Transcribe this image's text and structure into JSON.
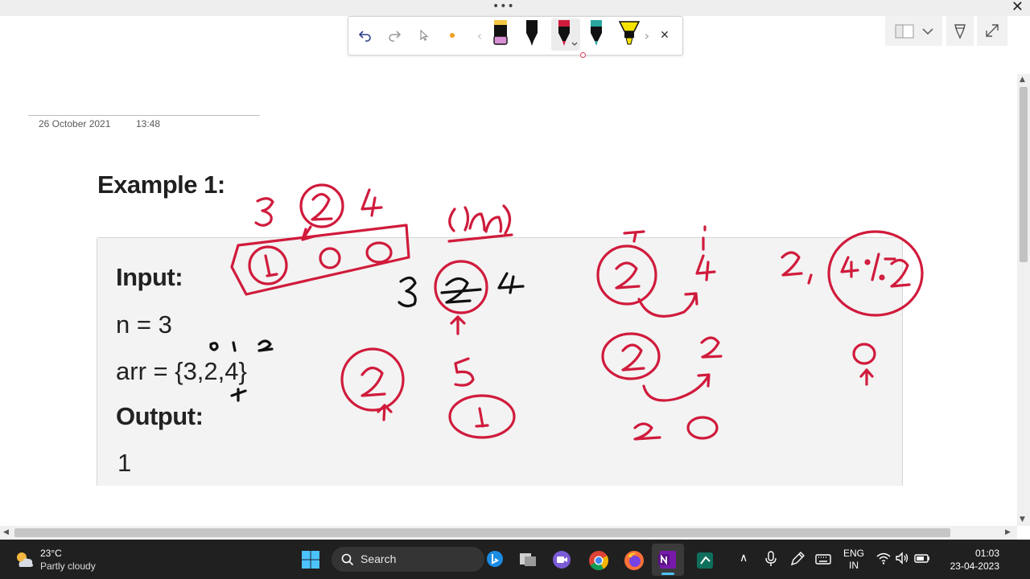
{
  "window": {
    "grip_label": "•••",
    "close_glyph": "✕"
  },
  "pen_toolbar": {
    "prev_glyph": "‹",
    "next_glyph": "›",
    "close_glyph": "✕",
    "pens": [
      {
        "icon": "highlighter-pink-icon",
        "color": "#d98fd6"
      },
      {
        "icon": "black-pen-icon",
        "color": "#111111"
      },
      {
        "icon": "red-pen-icon",
        "color": "#d01b3c",
        "selected": true
      },
      {
        "icon": "teal-pen-icon",
        "color": "#2aa6a0"
      },
      {
        "icon": "yellow-highlighter-icon",
        "color": "#f5e300"
      }
    ]
  },
  "page": {
    "date": "26 October 2021",
    "time": "13:48"
  },
  "example": {
    "title": "Example 1:",
    "input_label": "Input:",
    "n_line": "n = 3",
    "arr_line": "arr = {3,2,4}",
    "output_label": "Output:",
    "output_value": "1"
  },
  "taskbar": {
    "weather_temp": "23°C",
    "weather_desc": "Partly cloudy",
    "search_label": "Search",
    "lang_line1": "ENG",
    "lang_line2": "IN",
    "time": "01:03",
    "date": "23-04-2023",
    "chevron_glyph": "∧"
  },
  "colors": {
    "ink_red": "#d01b3c",
    "ink_black": "#111111",
    "taskbar_bg": "#202020"
  }
}
